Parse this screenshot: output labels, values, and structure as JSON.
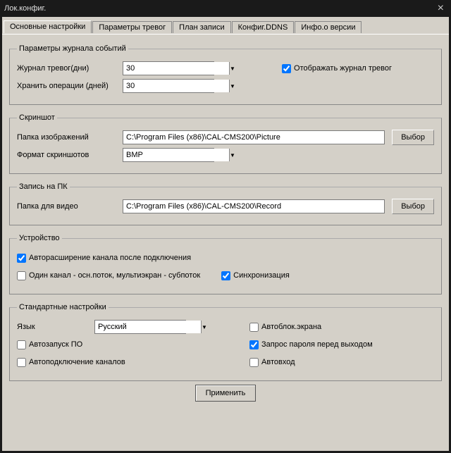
{
  "window": {
    "title": "Лок.конфиг."
  },
  "tabs": [
    {
      "label": "Основные настройки",
      "active": true
    },
    {
      "label": "Параметры тревог"
    },
    {
      "label": "План записи"
    },
    {
      "label": "Конфиг.DDNS"
    },
    {
      "label": "Инфо.о версии"
    }
  ],
  "eventlog": {
    "legend": "Параметры журнала событий",
    "alarm_days_label": "Журнал тревог(дни)",
    "alarm_days_value": "30",
    "op_days_label": "Хранить операции (дней)",
    "op_days_value": "30",
    "show_alarm_log_label": "Отображать журнал тревог",
    "show_alarm_log_checked": true
  },
  "screenshot": {
    "legend": "Скриншот",
    "folder_label": "Папка изображений",
    "folder_value": "C:\\Program Files (x86)\\CAL-CMS200\\Picture",
    "format_label": "Формат скриншотов",
    "format_value": "BMP",
    "choose_label": "Выбор"
  },
  "record": {
    "legend": "Запись на ПК",
    "folder_label": "Папка для видео",
    "folder_value": "C:\\Program Files (x86)\\CAL-CMS200\\Record",
    "choose_label": "Выбор"
  },
  "device": {
    "legend": "Устройство",
    "autoexpand_label": "Авторасширение канала после подключения",
    "autoexpand_checked": true,
    "onechannel_label": "Один канал - осн.поток, мультиэкран - субпоток",
    "onechannel_checked": false,
    "sync_label": "Синхронизация",
    "sync_checked": true
  },
  "standard": {
    "legend": "Стандартные настройки",
    "language_label": "Язык",
    "language_value": "Русский",
    "autoblock_label": "Автоблок.экрана",
    "autoblock_checked": false,
    "autorun_label": "Автозапуск ПО",
    "autorun_checked": false,
    "askpass_label": "Запрос пароля перед выходом",
    "askpass_checked": true,
    "autoconnect_label": "Автоподключение каналов",
    "autoconnect_checked": false,
    "autologin_label": "Автовход",
    "autologin_checked": false
  },
  "apply_label": "Применить"
}
